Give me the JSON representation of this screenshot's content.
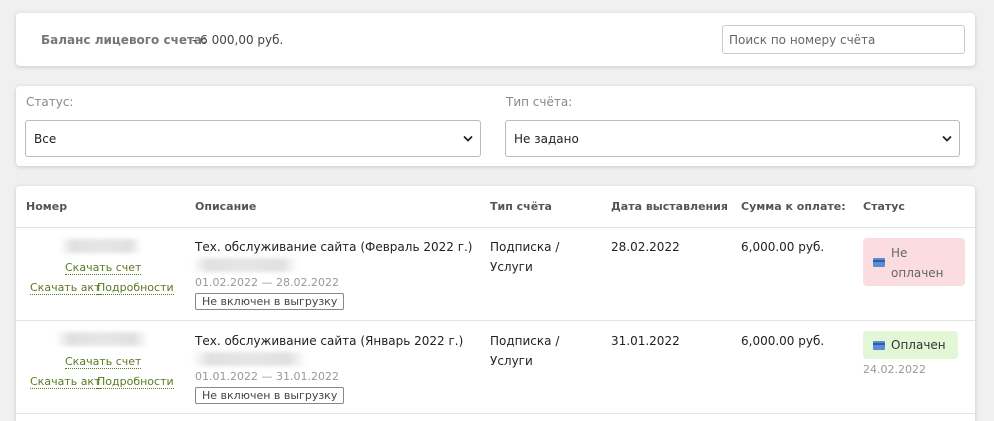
{
  "balance": {
    "label": "Баланс лицевого счета:",
    "value": "- 6 000,00 руб."
  },
  "search": {
    "placeholder": "Поиск по номеру счёта"
  },
  "filters": {
    "status_label": "Статус:",
    "status_value": "Все",
    "type_label": "Тип счёта:",
    "type_value": "Не задано"
  },
  "table": {
    "headers": {
      "number": "Номер",
      "description": "Описание",
      "type": "Тип счёта",
      "date": "Дата выставления",
      "sum": "Сумма к оплате:",
      "status": "Статус"
    },
    "rows": [
      {
        "link_invoice": "Скачать счет",
        "link_act": "Скачать акт",
        "link_details": "Подробности",
        "description": "Тех. обслуживание сайта (Февраль 2022 г.)",
        "period": "01.02.2022 — 28.02.2022",
        "tag": "Не включен в выгрузку",
        "type_line1": "Подписка /",
        "type_line2": "Услуги",
        "date": "28.02.2022",
        "sum": "6,000.00 руб.",
        "status_line1": "Не",
        "status_line2": "оплачен",
        "status_color": "#fbdde0",
        "paid_date": ""
      },
      {
        "link_invoice": "Скачать счет",
        "link_act": "Скачать акт",
        "link_details": "Подробности",
        "description": "Тех. обслуживание сайта (Январь 2022 г.)",
        "period": "01.01.2022 — 31.01.2022",
        "tag": "Не включен в выгрузку",
        "type_line1": "Подписка /",
        "type_line2": "Услуги",
        "date": "31.01.2022",
        "sum": "6,000.00 руб.",
        "status_line1": "Оплачен",
        "status_line2": "",
        "status_color": "#e3f6d6",
        "paid_date": "24.02.2022"
      }
    ]
  },
  "icons": {
    "status_icon": "credit-card-icon",
    "select_icon": "chevron-down-icon"
  }
}
